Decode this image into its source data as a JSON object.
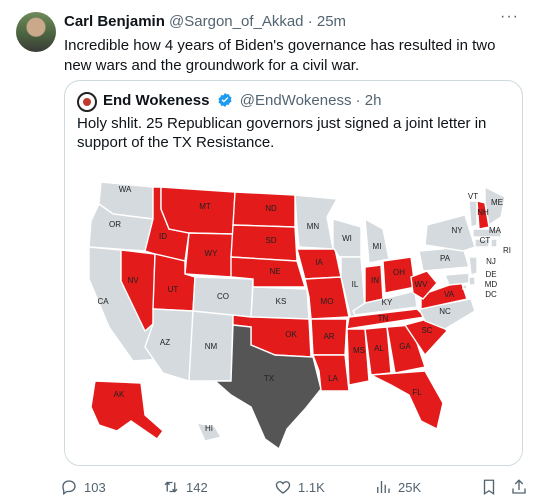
{
  "tweet": {
    "author_name": "Carl Benjamin",
    "author_handle": "@Sargon_of_Akkad",
    "separator": "·",
    "time": "25m",
    "text": "Incredible how 4 years of Biden's governance has resulted in two new wars and the groundwork for a civil war.",
    "more_label": "···"
  },
  "quoted": {
    "author_name": "End Wokeness",
    "author_handle": "@EndWokeness",
    "separator": "·",
    "time": "2h",
    "text": "Holy shlit. 25 Republican governors just signed a joint letter in support of the TX Resistance."
  },
  "map": {
    "colors": {
      "red": "#e31b1b",
      "gray": "#d4dadd",
      "texas": "#555555",
      "border": "#ffffff"
    },
    "labels": [
      "WA",
      "OR",
      "CA",
      "NV",
      "ID",
      "MT",
      "WY",
      "UT",
      "AZ",
      "NM",
      "CO",
      "ND",
      "SD",
      "NE",
      "KS",
      "OK",
      "TX",
      "MN",
      "IA",
      "MO",
      "AR",
      "LA",
      "WI",
      "IL",
      "MI",
      "IN",
      "OH",
      "KY",
      "TN",
      "MS",
      "AL",
      "GA",
      "FL",
      "SC",
      "NC",
      "VA",
      "WV",
      "PA",
      "NY",
      "VT",
      "NH",
      "ME",
      "MA",
      "CT",
      "RI",
      "NJ",
      "DE",
      "MD",
      "DC",
      "AK",
      "HI"
    ]
  },
  "actions": {
    "replies": "103",
    "reposts": "142",
    "likes": "1.1K",
    "views": "25K"
  }
}
